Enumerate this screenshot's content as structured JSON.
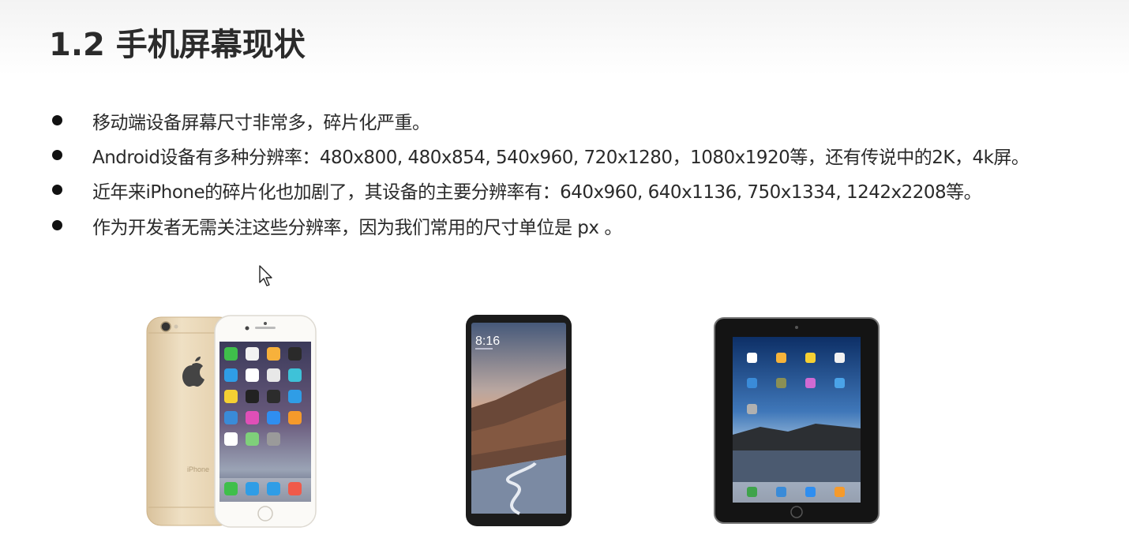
{
  "slide": {
    "title": "1.2 手机屏幕现状",
    "bullets": [
      "移动端设备屏幕尺寸非常多，碎片化严重。",
      "Android设备有多种分辨率：480x800, 480x854, 540x960, 720x1280，1080x1920等，还有传说中的2K，4k屏。",
      "近年来iPhone的碎片化也加剧了，其设备的主要分辨率有：640x960, 640x1136, 750x1334, 1242x2208等。",
      "作为开发者无需关注这些分辨率，因为我们常用的尺寸单位是 px 。"
    ]
  },
  "images": [
    {
      "name": "iphone-gold",
      "label": "iPhone"
    },
    {
      "name": "android-phone",
      "time": "8:16"
    },
    {
      "name": "ipad"
    }
  ],
  "colors": {
    "gold": "#e6d2b0",
    "black": "#1b1b1b",
    "white": "#ffffff"
  }
}
